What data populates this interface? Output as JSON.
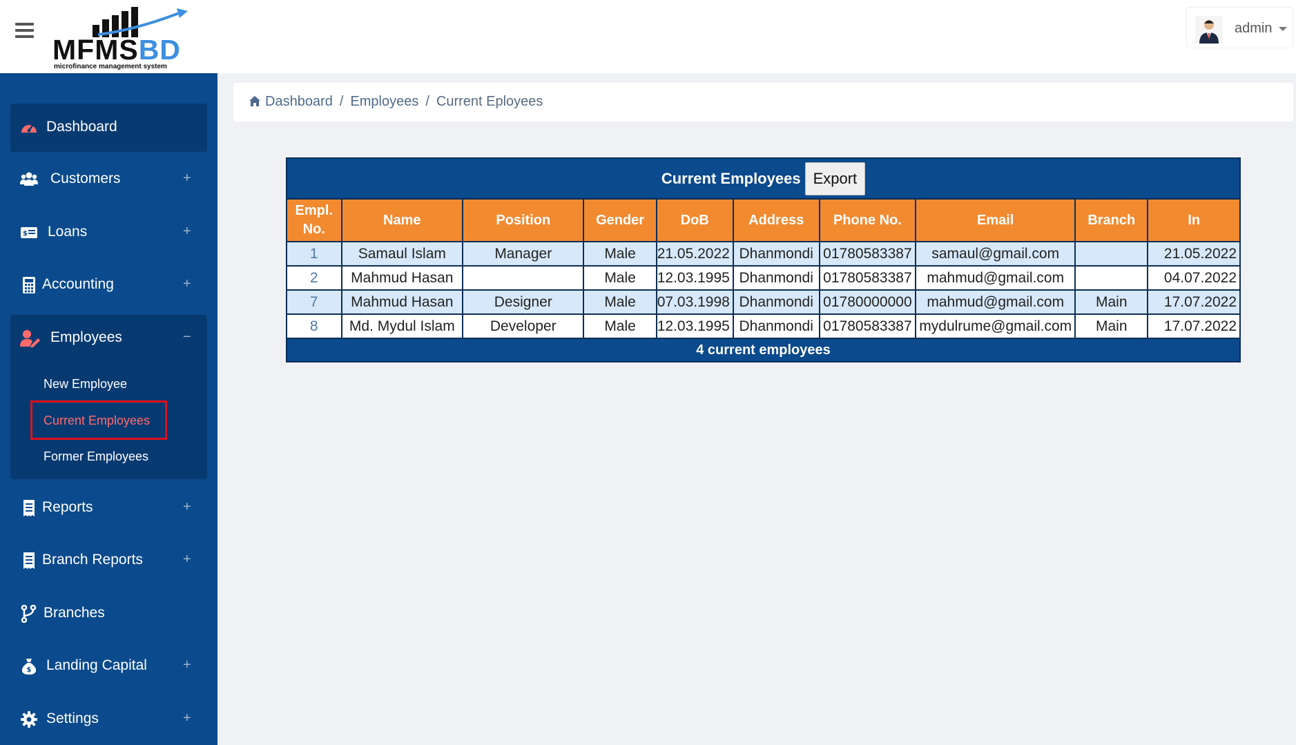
{
  "header": {
    "brand_main": "MFMS",
    "brand_accent": "BD",
    "tagline": "microfinance management system",
    "user_name": "admin"
  },
  "sidebar": {
    "items": [
      {
        "label": "Dashboard",
        "icon": "dashboard-icon",
        "expand": ""
      },
      {
        "label": "Customers",
        "icon": "users-icon",
        "expand": "+"
      },
      {
        "label": "Loans",
        "icon": "money-card-icon",
        "expand": "+"
      },
      {
        "label": "Accounting",
        "icon": "calculator-icon",
        "expand": "+"
      },
      {
        "label": "Employees",
        "icon": "user-edit-icon",
        "expand": "−"
      },
      {
        "label": "Reports",
        "icon": "receipt-icon",
        "expand": "+"
      },
      {
        "label": "Branch Reports",
        "icon": "receipt-icon",
        "expand": "+"
      },
      {
        "label": "Branches",
        "icon": "branch-icon",
        "expand": ""
      },
      {
        "label": "Landing Capital",
        "icon": "money-bag-icon",
        "expand": "+"
      },
      {
        "label": "Settings",
        "icon": "gear-icon",
        "expand": "+"
      }
    ],
    "employee_submenu": [
      "New Employee",
      "Current Employees",
      "Former Employees"
    ]
  },
  "breadcrumb": {
    "items": [
      "Dashboard",
      "Employees"
    ],
    "current": "Current Eployees",
    "separator": "/"
  },
  "table": {
    "title": "Current Employees",
    "export_label": "Export",
    "headers": [
      "Empl. No.",
      "Name",
      "Position",
      "Gender",
      "DoB",
      "Address",
      "Phone No.",
      "Email",
      "Branch",
      "In"
    ],
    "rows": [
      {
        "no": "1",
        "name": "Samaul Islam",
        "position": "Manager",
        "gender": "Male",
        "dob": "21.05.2022",
        "address": "Dhanmondi",
        "phone": "01780583387",
        "email": "samaul@gmail.com",
        "branch": "",
        "in": "21.05.2022"
      },
      {
        "no": "2",
        "name": "Mahmud Hasan",
        "position": "",
        "gender": "Male",
        "dob": "12.03.1995",
        "address": "Dhanmondi",
        "phone": "01780583387",
        "email": "mahmud@gmail.com",
        "branch": "",
        "in": "04.07.2022"
      },
      {
        "no": "7",
        "name": "Mahmud Hasan",
        "position": "Designer",
        "gender": "Male",
        "dob": "07.03.1998",
        "address": "Dhanmondi",
        "phone": "01780000000",
        "email": "mahmud@gmail.com",
        "branch": "Main",
        "in": "17.07.2022"
      },
      {
        "no": "8",
        "name": "Md. Mydul Islam",
        "position": "Developer",
        "gender": "Male",
        "dob": "12.03.1995",
        "address": "Dhanmondi",
        "phone": "01780583387",
        "email": "mydulrume@gmail.com",
        "branch": "Main",
        "in": "17.07.2022"
      }
    ],
    "footer": "4 current employees"
  },
  "colors": {
    "sidebar_bg": "#0b4a8c",
    "sidebar_active": "#083a72",
    "header_orange": "#f28a30",
    "row_highlight": "#d7e8fa",
    "accent_red": "#e0101a"
  }
}
